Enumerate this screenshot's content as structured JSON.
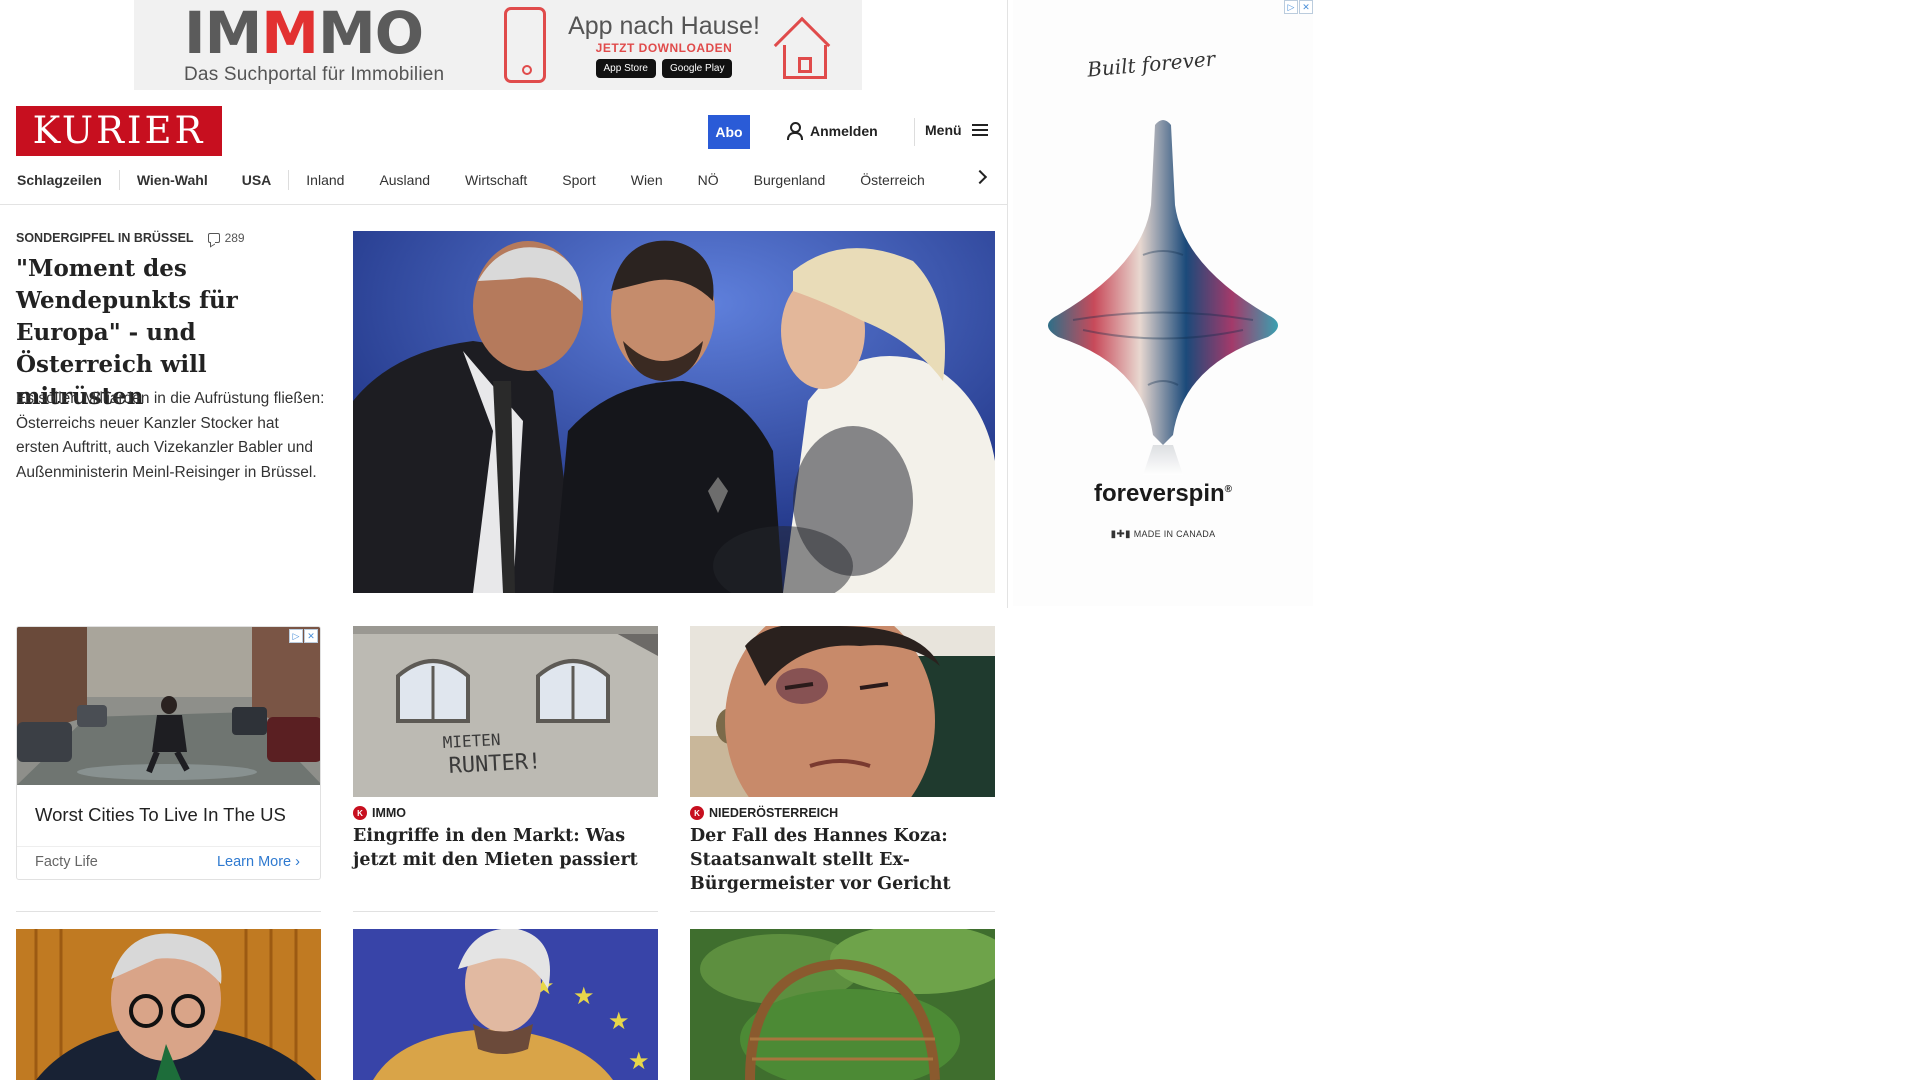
{
  "top_ad": {
    "brand_prefix": "IM",
    "brand_mid": "M",
    "brand_suffix": "MO",
    "tagline": "Das Suchportal für Immobilien",
    "app_title": "App nach Hause!",
    "app_cta": "JETZT DOWNLOADEN",
    "store_apple": "App Store",
    "store_google": "Google Play",
    "accent": "#e23131"
  },
  "header": {
    "logo": "KURIER",
    "abo_label": "Abo",
    "login_label": "Anmelden",
    "menu_label": "Menü",
    "brand_color": "#c70f1f",
    "abo_color": "#2a5bd7"
  },
  "nav": {
    "items": [
      "Schlagzeilen",
      "Wien-Wahl",
      "USA",
      "Inland",
      "Ausland",
      "Wirtschaft",
      "Sport",
      "Wien",
      "NÖ",
      "Burgenland",
      "Österreich"
    ]
  },
  "lead": {
    "kicker": "SONDERGIPFEL IN BRÜSSEL",
    "comment_count": "289",
    "title": "\"Moment des Wendepunkts für Europa\" - und Österreich will mitrüsten",
    "teaser": "Es sollen Milliarden in die Aufrüstung fließen: Österreichs neuer Kanzler Stocker hat ersten Auftritt, auch Vizekanzler Babler und Außenministerin Meinl-Reisinger in Brüssel."
  },
  "sponsored": {
    "title": "Worst Cities To Live In The US",
    "source": "Facty Life",
    "cta": "Learn More"
  },
  "cards": [
    {
      "kicker": "IMMO",
      "title": "Eingriffe in den Markt: Was jetzt mit den Mieten passiert",
      "graffiti_line1": "MIETEN",
      "graffiti_line2": "RUNTER!"
    },
    {
      "kicker": "NIEDERÖSTERREICH",
      "title": "Der Fall des Hannes Koza: Staatsanwalt stellt Ex-Bürgermeister vor Gericht"
    }
  ],
  "side_ad": {
    "signature": "Built forever",
    "brand": "foreverspin",
    "made_in": "MADE IN CANADA"
  }
}
